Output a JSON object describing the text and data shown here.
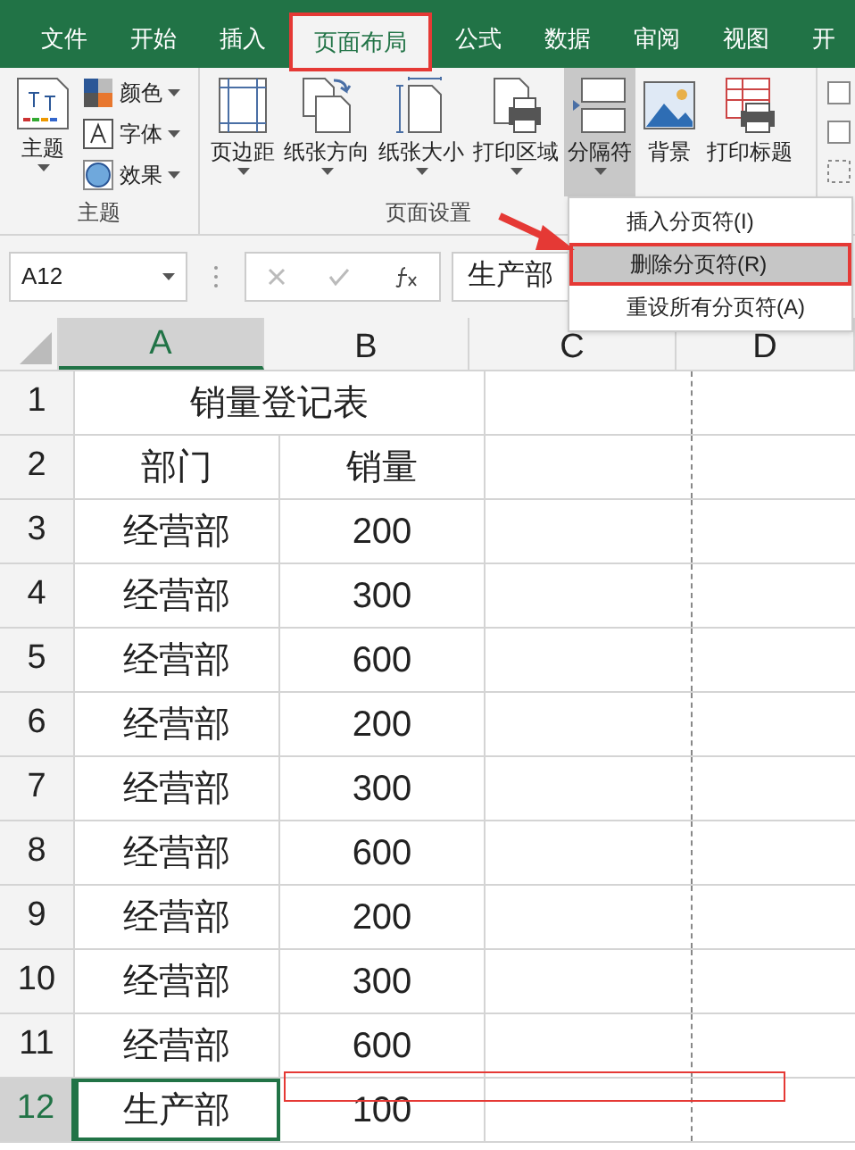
{
  "tabs": [
    {
      "label": "文件",
      "selected": false
    },
    {
      "label": "开始",
      "selected": false
    },
    {
      "label": "插入",
      "selected": false
    },
    {
      "label": "页面布局",
      "selected": true
    },
    {
      "label": "公式",
      "selected": false
    },
    {
      "label": "数据",
      "selected": false
    },
    {
      "label": "审阅",
      "selected": false
    },
    {
      "label": "视图",
      "selected": false
    },
    {
      "label": "开",
      "selected": false
    }
  ],
  "ribbon": {
    "theme_group": {
      "label": "主题",
      "button": "主题",
      "small": [
        {
          "kind": "colors",
          "label": "颜色"
        },
        {
          "kind": "fonts",
          "label": "字体"
        },
        {
          "kind": "effects",
          "label": "效果"
        }
      ]
    },
    "page_setup_group": {
      "label": "页面设置",
      "buttons": [
        {
          "kind": "margins",
          "label": "页边距",
          "dropdown": true,
          "pressed": false
        },
        {
          "kind": "orientation",
          "label": "纸张方向",
          "dropdown": true,
          "pressed": false
        },
        {
          "kind": "size",
          "label": "纸张大小",
          "dropdown": true,
          "pressed": false
        },
        {
          "kind": "print_area",
          "label": "打印区域",
          "dropdown": true,
          "pressed": false
        },
        {
          "kind": "breaks",
          "label": "分隔符",
          "dropdown": true,
          "pressed": true
        },
        {
          "kind": "background",
          "label": "背景",
          "dropdown": false,
          "pressed": false
        },
        {
          "kind": "print_titles",
          "label": "打印标题",
          "dropdown": false,
          "pressed": false
        }
      ]
    }
  },
  "menu": [
    {
      "label": "插入分页符(I)",
      "selected": false
    },
    {
      "label": "删除分页符(R)",
      "selected": true
    },
    {
      "label": "重设所有分页符(A)",
      "selected": false
    }
  ],
  "name_box": "A12",
  "formula": "生产部",
  "columns": [
    {
      "label": "A",
      "selected": true
    },
    {
      "label": "B",
      "selected": false
    },
    {
      "label": "C",
      "selected": false
    },
    {
      "label": "D",
      "selected": false
    }
  ],
  "rows": [
    {
      "number": "1",
      "title": "销量登记表",
      "selected": false
    },
    {
      "number": "2",
      "cells": [
        "部门",
        "销量"
      ],
      "selected": false
    },
    {
      "number": "3",
      "cells": [
        "经营部",
        "200"
      ],
      "selected": false
    },
    {
      "number": "4",
      "cells": [
        "经营部",
        "300"
      ],
      "selected": false
    },
    {
      "number": "5",
      "cells": [
        "经营部",
        "600"
      ],
      "selected": false
    },
    {
      "number": "6",
      "cells": [
        "经营部",
        "200"
      ],
      "selected": false
    },
    {
      "number": "7",
      "cells": [
        "经营部",
        "300"
      ],
      "selected": false
    },
    {
      "number": "8",
      "cells": [
        "经营部",
        "600"
      ],
      "selected": false
    },
    {
      "number": "9",
      "cells": [
        "经营部",
        "200"
      ],
      "selected": false
    },
    {
      "number": "10",
      "cells": [
        "经营部",
        "300"
      ],
      "selected": false
    },
    {
      "number": "11",
      "cells": [
        "经营部",
        "600"
      ],
      "selected": false
    },
    {
      "number": "12",
      "cells": [
        "生产部",
        "100"
      ],
      "selected": true
    }
  ]
}
